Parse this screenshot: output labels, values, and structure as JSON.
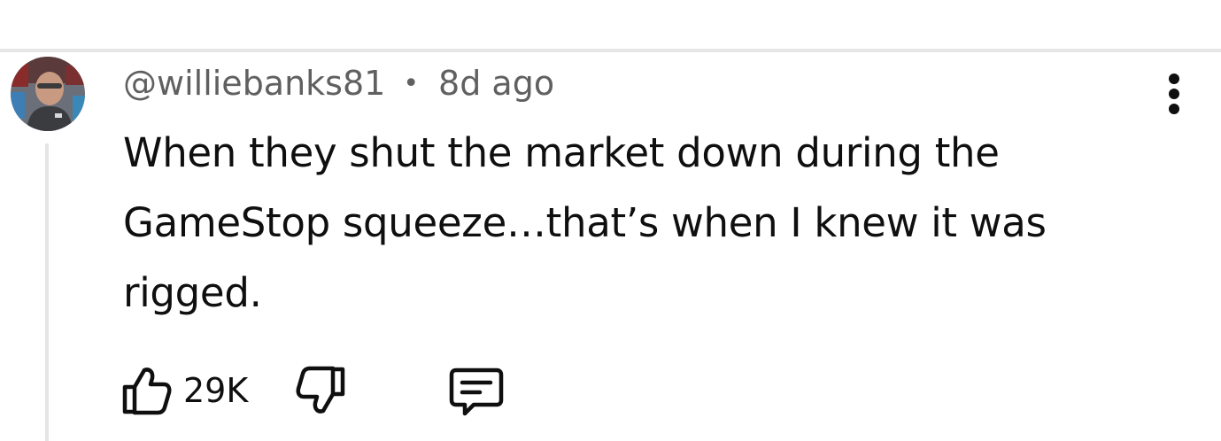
{
  "comment": {
    "author": "@williebanks81",
    "separator": "•",
    "timestamp": "8d ago",
    "text": "When they shut the market down during the GameStop squeeze…that’s when I knew it was rigged.",
    "like_count": "29K"
  },
  "icons": {
    "like": "thumbs-up-icon",
    "dislike": "thumbs-down-icon",
    "reply": "comment-reply-icon",
    "menu": "more-vertical-icon",
    "avatar": "user-avatar"
  },
  "colors": {
    "text": "#0f0f0f",
    "meta": "#606060",
    "divider": "#e6e6e6",
    "thread_line": "#e5e5e5"
  }
}
